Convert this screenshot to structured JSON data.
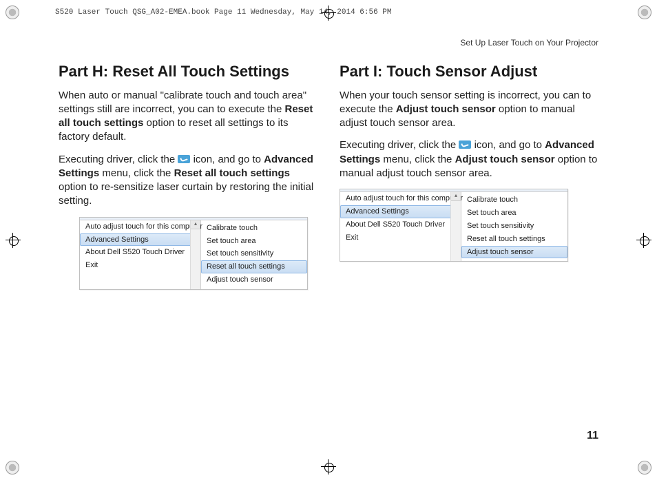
{
  "book_header": "S520 Laser Touch QSG_A02-EMEA.book  Page 11  Wednesday, May 14, 2014  6:56 PM",
  "running_head": "Set Up Laser Touch on Your Projector",
  "page_number": "11",
  "left": {
    "title": "Part H: Reset All Touch Settings",
    "p1a": "When auto or manual \"calibrate touch and touch area\" settings still are incorrect, you can to execute the ",
    "p1b_bold": "Reset all touch settings",
    "p1c": " option to reset all settings to its factory default.",
    "p2a": "Executing driver, click the ",
    "p2b": " icon, and go to ",
    "p2c_bold": "Advanced Settings",
    "p2d": " menu, click the ",
    "p2e_bold": "Reset all touch settings",
    "p2f": " option to re-sensitize laser curtain by restoring the initial setting.",
    "menu": {
      "main": [
        "Auto adjust touch for this computer",
        "Advanced Settings",
        "About Dell S520 Touch Driver",
        "Exit"
      ],
      "selected_main_index": 1,
      "sub": [
        "Calibrate touch",
        "Set touch area",
        "Set touch sensitivity",
        "Reset all touch settings",
        "Adjust touch sensor"
      ],
      "selected_sub_index": 3
    }
  },
  "right": {
    "title": "Part I: Touch Sensor Adjust",
    "p1a": "When your touch sensor setting is incorrect, you can to execute the ",
    "p1b_bold": "Adjust touch sensor",
    "p1c": " option to manual adjust touch sensor area.",
    "p2a": "Executing driver, click the ",
    "p2b": " icon, and go to ",
    "p2c_bold": "Advanced Settings",
    "p2d": " menu, click the ",
    "p2e_bold": "Adjust touch sensor",
    "p2f": " option to manual adjust touch sensor area.",
    "menu": {
      "main": [
        "Auto adjust touch for this computer",
        "Advanced Settings",
        "About Dell S520 Touch Driver",
        "Exit"
      ],
      "selected_main_index": 1,
      "sub": [
        "Calibrate touch",
        "Set touch area",
        "Set touch sensitivity",
        "Reset all touch settings",
        "Adjust touch sensor"
      ],
      "selected_sub_index": 4
    }
  }
}
